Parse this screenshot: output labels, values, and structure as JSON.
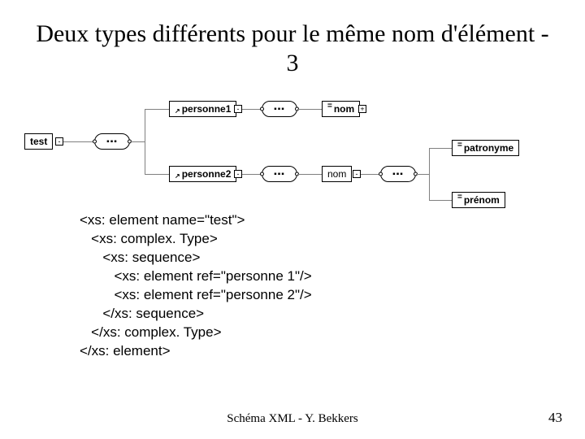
{
  "title": "Deux types différents pour le même nom d'élément - 3",
  "diagram": {
    "test": "test",
    "personne1": "personne1",
    "personne2": "personne2",
    "nom1": "nom",
    "nom2": "nom",
    "patronyme": "patronyme",
    "prenom": "prénom",
    "dots": "▪▪▪"
  },
  "code": {
    "l1": "<xs: element name=\"test\">",
    "l2": "   <xs: complex. Type>",
    "l3": "      <xs: sequence>",
    "l4": "         <xs: element ref=\"personne 1\"/>",
    "l5": "         <xs: element ref=\"personne 2\"/>",
    "l6": "      </xs: sequence>",
    "l7": "   </xs: complex. Type>",
    "l8": "</xs: element>"
  },
  "footer": "Schéma XML - Y. Bekkers",
  "page": "43"
}
